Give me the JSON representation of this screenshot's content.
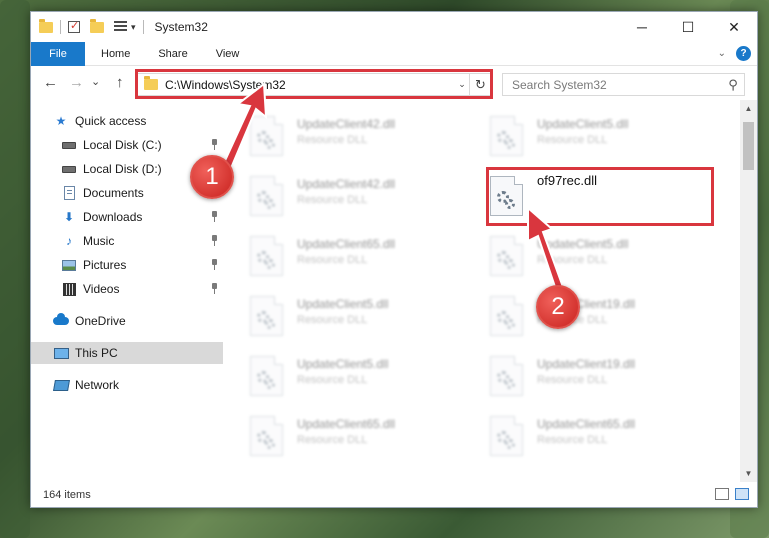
{
  "window": {
    "title": "System32",
    "controls": {
      "minimize": "─",
      "maximize": "☐",
      "close": "✕"
    }
  },
  "ribbon": {
    "file_tab": "File",
    "tabs": [
      "Home",
      "Share",
      "View"
    ],
    "help": "?"
  },
  "nav": {
    "back": "←",
    "forward": "→",
    "recent": "⌄",
    "up": "↑",
    "address": "C:\\Windows\\System32",
    "refresh": "↻",
    "search_placeholder": "Search System32",
    "search_icon": "⚲"
  },
  "sidebar": {
    "items": [
      {
        "label": "Quick access",
        "icon": "star-icon",
        "pinned": false
      },
      {
        "label": "Local Disk (C:)",
        "icon": "drive-icon",
        "pinned": true
      },
      {
        "label": "Local Disk (D:)",
        "icon": "drive-icon",
        "pinned": false
      },
      {
        "label": "Documents",
        "icon": "documents-icon",
        "pinned": true
      },
      {
        "label": "Downloads",
        "icon": "download-icon",
        "pinned": true
      },
      {
        "label": "Music",
        "icon": "music-icon",
        "pinned": true
      },
      {
        "label": "Pictures",
        "icon": "pictures-icon",
        "pinned": true
      },
      {
        "label": "Videos",
        "icon": "videos-icon",
        "pinned": true
      },
      {
        "label": "OneDrive",
        "icon": "onedrive-icon",
        "pinned": false
      },
      {
        "label": "This PC",
        "icon": "this-pc-icon",
        "pinned": false,
        "selected": true
      },
      {
        "label": "Network",
        "icon": "network-icon",
        "pinned": false
      }
    ]
  },
  "files": {
    "left_column": [
      {
        "name": "UpdateClient42.dll",
        "type": "Resource DLL"
      },
      {
        "name": "UpdateClient42.dll",
        "type": "Resource DLL"
      },
      {
        "name": "UpdateClient65.dll",
        "type": "Resource DLL"
      },
      {
        "name": "UpdateClient5.dll",
        "type": "Resource DLL"
      },
      {
        "name": "UpdateClient5.dll",
        "type": "Resource DLL"
      },
      {
        "name": "UpdateClient65.dll",
        "type": "Resource DLL"
      }
    ],
    "right_column": [
      {
        "name": "UpdateClient5.dll",
        "type": "Resource DLL"
      },
      {
        "name": "of97rec.dll",
        "type": "",
        "highlighted": true
      },
      {
        "name": "UpdateClient5.dll",
        "type": "Resource DLL"
      },
      {
        "name": "UpdateClient19.dll",
        "type": "Resource DLL"
      },
      {
        "name": "UpdateClient19.dll",
        "type": "Resource DLL"
      },
      {
        "name": "UpdateClient65.dll",
        "type": "Resource DLL"
      }
    ]
  },
  "status": {
    "item_count": "164 items"
  },
  "callouts": {
    "step1": "1",
    "step2": "2",
    "color": "#d9363e"
  }
}
